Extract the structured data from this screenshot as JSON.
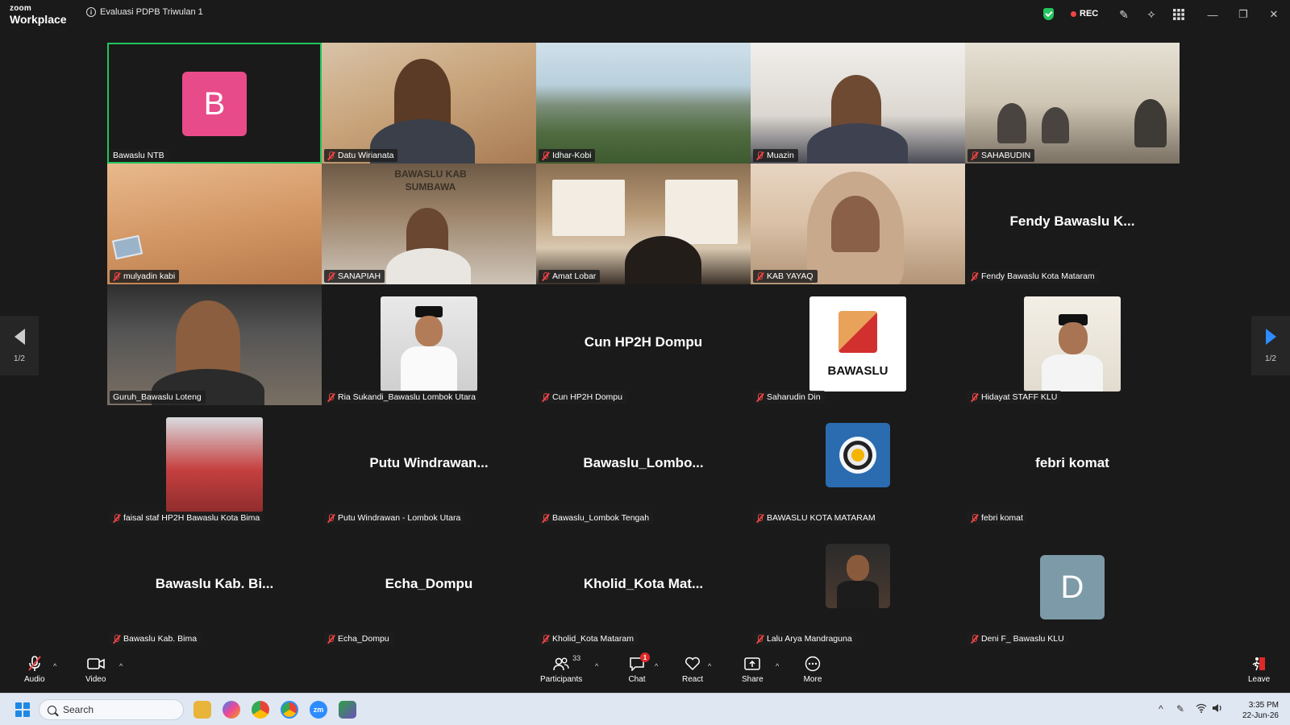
{
  "app": {
    "brand_top": "zoom",
    "brand_bottom": "Workplace",
    "meeting_title": "Evaluasi PDPB Triwulan 1",
    "rec_label": "REC"
  },
  "colors": {
    "active_border": "#22c55e",
    "muted_mic": "#ef4444",
    "accent": "#2d8cff",
    "avatar_b": "#e84b8a",
    "avatar_d": "#7d9aa8"
  },
  "nav": {
    "page_left": "1/2",
    "page_right": "1/2"
  },
  "participants": [
    {
      "name": "Bawaslu NTB",
      "display": "B"
    },
    {
      "name": "Datu Wirianata"
    },
    {
      "name": "Idhar-Kobi"
    },
    {
      "name": "Muazin"
    },
    {
      "name": "SAHABUDIN"
    },
    {
      "name": "mulyadin kabi"
    },
    {
      "name": "SANAPIAH",
      "video_text": "BAWASLU KAB SUMBAWA"
    },
    {
      "name": "Amat Lobar"
    },
    {
      "name": "KAB YAYAQ"
    },
    {
      "name": "Fendy Bawaslu Kota Mataram",
      "display": "Fendy Bawaslu K..."
    },
    {
      "name": "Guruh_Bawaslu Loteng"
    },
    {
      "name": "Ria Sukandi_Bawaslu Lombok Utara"
    },
    {
      "name": "Cun HP2H Dompu",
      "display": "Cun HP2H Dompu"
    },
    {
      "name": "Saharudin Din",
      "logo_text": "BAWASLU"
    },
    {
      "name": "Hidayat STAFF KLU"
    },
    {
      "name": "faisal staf HP2H Bawaslu Kota Bima"
    },
    {
      "name": "Putu Windrawan - Lombok Utara",
      "display": "Putu Windrawan..."
    },
    {
      "name": "Bawaslu_Lombok Tengah",
      "display": "Bawaslu_Lombo..."
    },
    {
      "name": "BAWASLU KOTA MATARAM"
    },
    {
      "name": "febri komat",
      "display": "febri komat"
    },
    {
      "name": "Bawaslu Kab. Bima",
      "display": "Bawaslu Kab. Bi..."
    },
    {
      "name": "Echa_Dompu",
      "display": "Echa_Dompu"
    },
    {
      "name": "Kholid_Kota Mataram",
      "display": "Kholid_Kota Mat..."
    },
    {
      "name": "Lalu Arya Mandraguna"
    },
    {
      "name": "Deni F_ Bawaslu KLU",
      "display": "D"
    }
  ],
  "toolbar": {
    "audio": "Audio",
    "video": "Video",
    "participants": "Participants",
    "participants_count": "33",
    "chat": "Chat",
    "chat_badge": "1",
    "react": "React",
    "share": "Share",
    "more": "More",
    "leave": "Leave"
  },
  "taskbar": {
    "search_placeholder": "Search",
    "time": "3:35 PM",
    "date": "22-Jun-26"
  }
}
